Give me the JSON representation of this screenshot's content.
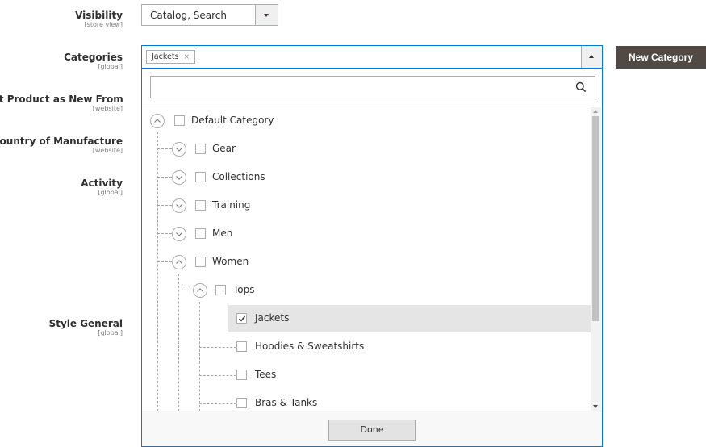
{
  "fields": {
    "visibility": {
      "label": "Visibility",
      "scope": "[store view]",
      "value": "Catalog, Search"
    },
    "categories": {
      "label": "Categories",
      "scope": "[global]",
      "selected_tag": "Jackets",
      "tag_remove": "×"
    },
    "new_from": {
      "label": "Set Product as New From",
      "scope": "[website]"
    },
    "country": {
      "label": "Country of Manufacture",
      "scope": "[website]"
    },
    "activity": {
      "label": "Activity",
      "scope": "[global]"
    },
    "style_general": {
      "label": "Style General",
      "scope": "[global]"
    }
  },
  "new_category_button": "New Category",
  "search": {
    "placeholder": ""
  },
  "tree": [
    {
      "label": "Default Category",
      "expanded": true,
      "checked": false
    },
    {
      "label": "Gear",
      "expanded": false,
      "checked": false
    },
    {
      "label": "Collections",
      "expanded": false,
      "checked": false
    },
    {
      "label": "Training",
      "expanded": false,
      "checked": false
    },
    {
      "label": "Men",
      "expanded": false,
      "checked": false
    },
    {
      "label": "Women",
      "expanded": true,
      "checked": false
    },
    {
      "label": "Tops",
      "expanded": true,
      "checked": false
    },
    {
      "label": "Jackets",
      "checked": true,
      "selected": true
    },
    {
      "label": "Hoodies & Sweatshirts",
      "checked": false
    },
    {
      "label": "Tees",
      "checked": false
    },
    {
      "label": "Bras & Tanks",
      "checked": false
    }
  ],
  "done_button": "Done",
  "colors": {
    "focus_border": "#007bdb",
    "button_dark": "#514943",
    "selected_row": "#e5e5e5"
  }
}
